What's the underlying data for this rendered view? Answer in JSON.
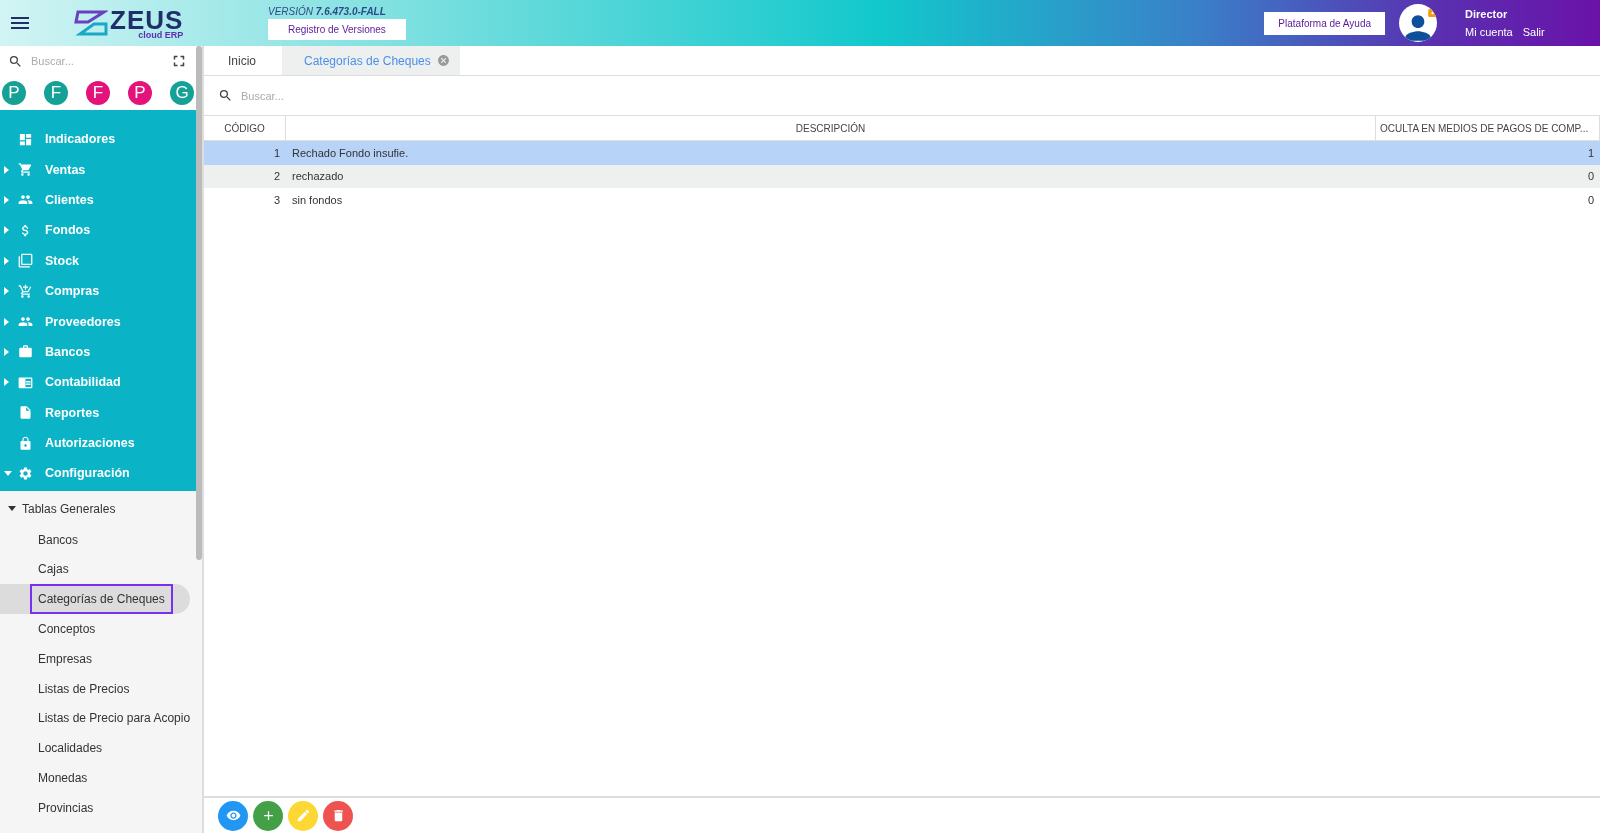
{
  "header": {
    "logo": {
      "title": "ZEUS",
      "subtitle": "cloud ERP"
    },
    "version": "VERSIÓN **7.6.473.0-FALL**",
    "versions_button": "Registro de Versiones",
    "help_button": "Plataforma de Ayuda",
    "user": {
      "role": "Director",
      "links": [
        "Mi cuenta",
        "Salir"
      ]
    }
  },
  "sidebar": {
    "search": {
      "placeholder": "Buscar..."
    },
    "shortcuts": [
      {
        "letter": "P",
        "color": "#16a196"
      },
      {
        "letter": "F",
        "color": "#16a196"
      },
      {
        "letter": "F",
        "color": "#e3137b"
      },
      {
        "letter": "P",
        "color": "#e3137b"
      },
      {
        "letter": "G",
        "color": "#16a196"
      }
    ],
    "menu": [
      {
        "label": "Indicadores"
      },
      {
        "label": "Ventas",
        "expanded": false
      },
      {
        "label": "Clientes",
        "expanded": false
      },
      {
        "label": "Fondos",
        "expanded": false
      },
      {
        "label": "Stock",
        "expanded": false
      },
      {
        "label": "Compras",
        "expanded": false
      },
      {
        "label": "Proveedores",
        "expanded": false
      },
      {
        "label": "Bancos",
        "expanded": false
      },
      {
        "label": "Contabilidad",
        "expanded": false
      },
      {
        "label": "Reportes"
      },
      {
        "label": "Autorizaciones"
      },
      {
        "label": "Configuración",
        "expanded": true,
        "children": [
          {
            "label": "Tablas Generales",
            "expanded": true,
            "children": [
              {
                "label": "Bancos",
                "selected": false
              },
              {
                "label": "Cajas",
                "selected": false
              },
              {
                "label": "Categorías de Cheques",
                "selected": true
              },
              {
                "label": "Conceptos",
                "selected": false
              },
              {
                "label": "Empresas",
                "selected": false
              },
              {
                "label": "Listas de Precios",
                "selected": false
              },
              {
                "label": "Listas de Precio para Acopio",
                "selected": false
              },
              {
                "label": "Localidades",
                "selected": false
              },
              {
                "label": "Monedas",
                "selected": false
              },
              {
                "label": "Provincias",
                "selected": false
              }
            ]
          }
        ]
      }
    ]
  },
  "tabs": [
    {
      "label": "Inicio",
      "selected": false,
      "closable": false
    },
    {
      "label": "Categorías de Cheques",
      "selected": true,
      "closable": true
    }
  ],
  "search": {
    "placeholder": "Buscar..."
  },
  "table": {
    "columns": [
      "CÓDIGO",
      "DESCRIPCIÓN",
      "OCULTA EN MEDIOS DE PAGOS DE COMP..."
    ],
    "rows": [
      {
        "cells": [
          "1",
          "Rechado Fondo insufie.",
          "1"
        ],
        "selected": true
      },
      {
        "cells": [
          "2",
          "rechazado",
          "0"
        ],
        "selected": false
      },
      {
        "cells": [
          "3",
          "sin fondos",
          "0"
        ],
        "selected": false
      }
    ]
  },
  "actions": [
    {
      "kind": "view",
      "color": "#2196f3"
    },
    {
      "kind": "add",
      "color": "#43a047"
    },
    {
      "kind": "edit",
      "color": "#fdd835"
    },
    {
      "kind": "delete",
      "color": "#ef5350"
    }
  ]
}
